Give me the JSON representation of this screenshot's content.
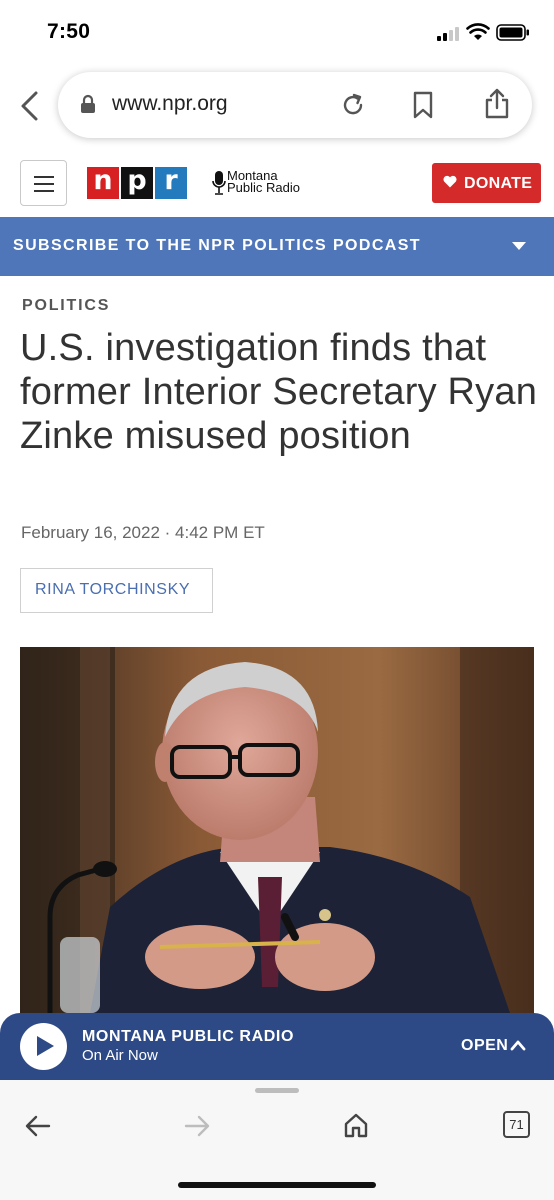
{
  "status_bar": {
    "time": "7:50",
    "icons": [
      "cellular-signal-icon",
      "wifi-icon",
      "battery-icon"
    ]
  },
  "browser": {
    "url": "www.npr.org",
    "icons": [
      "back-chevron-icon",
      "lock-icon",
      "reload-icon",
      "bookmark-icon",
      "share-icon"
    ]
  },
  "site_header": {
    "npr_logo_letters": [
      "n",
      "p",
      "r"
    ],
    "npr_logo_colors": [
      "#d62021",
      "#111111",
      "#237bbd"
    ],
    "station_logo_line1": "Montana",
    "station_logo_line2": "Public Radio",
    "donate_label": "DONATE",
    "donate_color": "#d42a2a"
  },
  "subscribe_banner": {
    "label": "SUBSCRIBE TO THE NPR POLITICS PODCAST",
    "color": "#5076ba"
  },
  "article": {
    "section": "POLITICS",
    "headline": "U.S. investigation finds that former Interior Secretary Ryan Zinke misused position",
    "dateline": "February 16, 2022 · 4:42 PM ET",
    "byline": "RINA TORCHINSKY"
  },
  "player": {
    "station": "MONTANA PUBLIC RADIO",
    "status": "On Air Now",
    "open_label": "OPEN",
    "color": "#2e4a86"
  },
  "toolbar": {
    "tab_count": "71",
    "icons": [
      "back-arrow-icon",
      "forward-arrow-icon",
      "home-icon",
      "tabs-icon"
    ]
  }
}
